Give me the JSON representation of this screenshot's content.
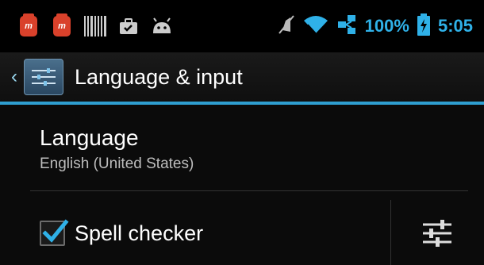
{
  "status_bar": {
    "notifications": [
      {
        "name": "app-m-icon"
      },
      {
        "name": "app-m-icon"
      },
      {
        "name": "barcode-icon"
      },
      {
        "name": "briefcase-icon"
      },
      {
        "name": "android-icon"
      }
    ],
    "battery_text": "100%",
    "clock": "5:05",
    "accent_color": "#2fb1e8"
  },
  "action_bar": {
    "title": "Language & input"
  },
  "preferences": {
    "language": {
      "title": "Language",
      "summary": "English (United States)"
    },
    "spell_checker": {
      "label": "Spell checker",
      "checked": true
    }
  }
}
